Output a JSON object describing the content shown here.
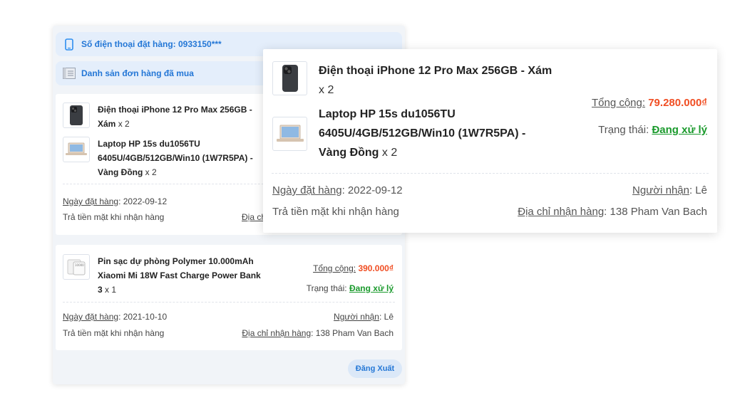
{
  "phone_bar": {
    "label": "Số điện thoại đặt hàng: 0933150***",
    "icon": "phone-icon"
  },
  "list_bar": {
    "label": "Danh sản đơn hàng đã mua",
    "icon": "list-icon"
  },
  "orders": [
    {
      "items": [
        {
          "name": "Điện thoại iPhone 12 Pro Max 256GB - Xám",
          "qty": "x 2",
          "thumb": "iphone-thumbnail"
        },
        {
          "name": "Laptop HP 15s du1056TU 6405U/4GB/512GB/Win10 (1W7R5PA) - Vàng Đồng",
          "qty": "x 2",
          "thumb": "laptop-thumbnail"
        }
      ],
      "order_date_label": "Ngày đặt hàng",
      "order_date": ": 2022-09-12",
      "payment": "Trả tiền mặt khi nhận hàng",
      "address_label_partial": "Địa ch"
    },
    {
      "items": [
        {
          "name": "Pin sạc dự phòng Polymer 10.000mAh Xiaomi Mi 18W Fast Charge Power Bank 3",
          "qty": "x 1",
          "thumb": "powerbank-thumbnail"
        }
      ],
      "total_label": "Tổng cộng:",
      "total_value": "390.000₫",
      "status_label": "Trạng thái:",
      "status_value": "Đang xử lý",
      "order_date_label": "Ngày đặt hàng",
      "order_date": ": 2021-10-10",
      "recipient_label": "Người nhận",
      "recipient": ": Lê",
      "payment": "Trả tiền mặt khi nhận hàng",
      "address_label": "Địa chỉ nhận hàng",
      "address": ": 138 Pham Van Bach"
    }
  ],
  "export_button": "Đăng Xuất",
  "zoom": {
    "item1_name": "Điện thoại iPhone 12 Pro Max 256GB - Xám",
    "item1_qty": "x 2",
    "item2_name": "Laptop HP 15s du1056TU 6405U/4GB/512GB/Win10 (1W7R5PA) - Vàng Đồng",
    "item2_qty": "x 2",
    "total_label": "Tổng cộng:",
    "total_value": "79.280.000₫",
    "status_label": "Trạng thái:",
    "status_value": "Đang xử lý",
    "order_date_label": "Ngày đặt hàng",
    "order_date": ": 2022-09-12",
    "recipient_label": "Người nhận",
    "recipient": ": Lê",
    "payment": "Trả tiền mặt khi nhận hàng",
    "address_label": "Địa chỉ nhận hàng",
    "address": ": 138 Pham Van Bach"
  },
  "colors": {
    "accent": "#2477d6",
    "price": "#f04e23",
    "status": "#1a9a2c",
    "panel_bg": "#f1f4f8",
    "bar_bg": "#e4eefb"
  }
}
